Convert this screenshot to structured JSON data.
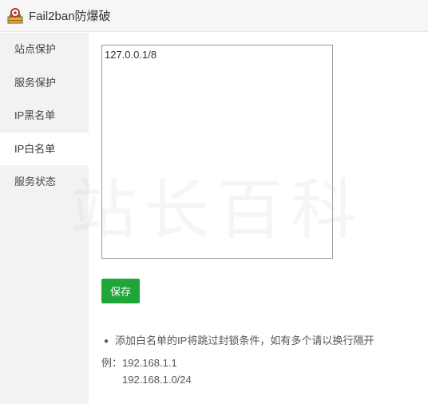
{
  "app": {
    "title": "Fail2ban防爆破",
    "icon": "fail2ban-app-icon"
  },
  "sidebar": {
    "items": [
      {
        "label": "站点保护",
        "active": false
      },
      {
        "label": "服务保护",
        "active": false
      },
      {
        "label": "IP黑名单",
        "active": false
      },
      {
        "label": "IP白名单",
        "active": true
      },
      {
        "label": "服务状态",
        "active": false
      }
    ]
  },
  "whitelist": {
    "value": "127.0.0.1/8"
  },
  "save_button": {
    "label": "保存",
    "color": "#20a53a"
  },
  "help": {
    "note": "添加白名单的IP将跳过封锁条件，如有多个请以换行隔开",
    "example_prefix": "例：",
    "example_1": "192.168.1.1",
    "example_2": "192.168.1.0/24"
  },
  "watermark": {
    "text": "站长百科"
  }
}
